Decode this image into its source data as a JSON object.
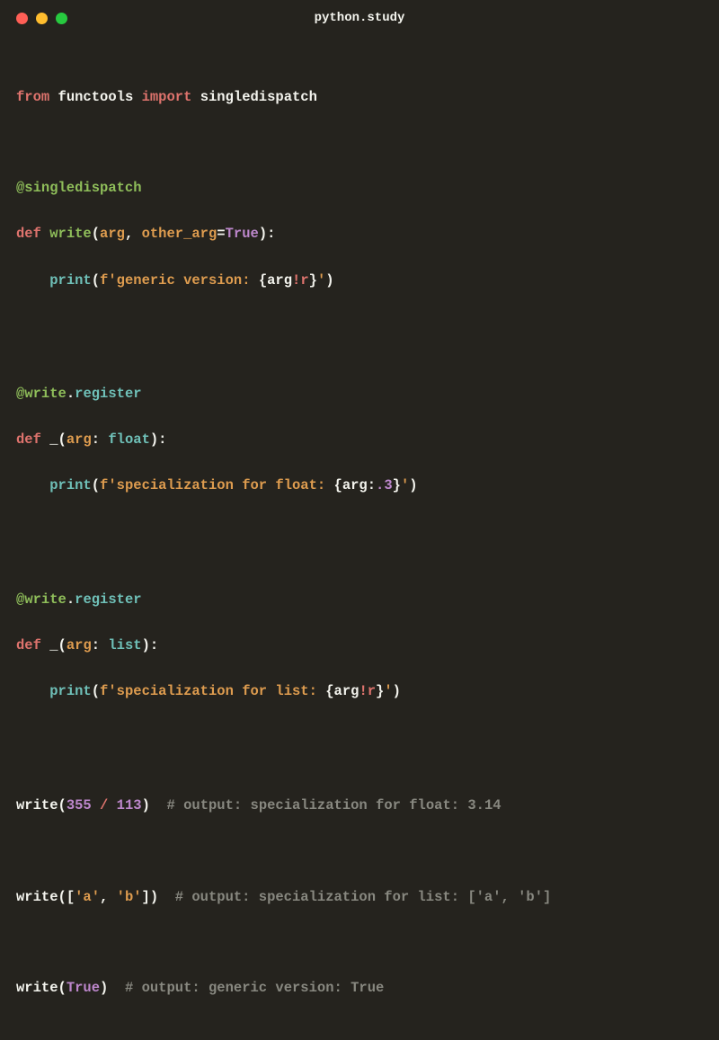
{
  "window": {
    "title": "python.study"
  },
  "code": {
    "l1": {
      "from": "from",
      "mod": "functools",
      "import": "import",
      "name": "singledispatch"
    },
    "l2": {
      "dec": "@singledispatch"
    },
    "l3": {
      "def": "def",
      "fn": "write",
      "lp": "(",
      "p1": "arg",
      "c1": ", ",
      "p2": "other_arg",
      "eq": "=",
      "true": "True",
      "rp": "):"
    },
    "l4": {
      "indent": "    ",
      "print": "print",
      "lp": "(",
      "f": "f",
      "q1": "'",
      "s1": "generic version: ",
      "lb": "{",
      "arg": "arg",
      "conv": "!r",
      "rb": "}",
      "q2": "'",
      "rp": ")"
    },
    "l5": {
      "at": "@",
      "name": "write",
      "dot": ".",
      "method": "register"
    },
    "l6": {
      "def": "def",
      "fn": "_",
      "lp": "(",
      "p1": "arg",
      "colon": ": ",
      "type": "float",
      "rp": "):"
    },
    "l7": {
      "indent": "    ",
      "print": "print",
      "lp": "(",
      "f": "f",
      "q1": "'",
      "s1": "specialization for float: ",
      "lb": "{",
      "arg": "arg",
      "colon": ":",
      "fmt": ".3",
      "rb": "}",
      "q2": "'",
      "rp": ")"
    },
    "l8": {
      "at": "@",
      "name": "write",
      "dot": ".",
      "method": "register"
    },
    "l9": {
      "def": "def",
      "fn": "_",
      "lp": "(",
      "p1": "arg",
      "colon": ": ",
      "type": "list",
      "rp": "):"
    },
    "l10": {
      "indent": "    ",
      "print": "print",
      "lp": "(",
      "f": "f",
      "q1": "'",
      "s1": "specialization for list: ",
      "lb": "{",
      "arg": "arg",
      "conv": "!r",
      "rb": "}",
      "q2": "'",
      "rp": ")"
    },
    "l11": {
      "fn": "write",
      "lp": "(",
      "n1": "355",
      "sp1": " ",
      "op": "/",
      "sp2": " ",
      "n2": "113",
      "rp": ")",
      "sp3": "  ",
      "comment": "# output: specialization for float: 3.14"
    },
    "l12": {
      "fn": "write",
      "lp": "([",
      "s1": "'a'",
      "c": ", ",
      "s2": "'b'",
      "rp": "])",
      "sp": "  ",
      "comment": "# output: specialization for list: ['a', 'b']"
    },
    "l13": {
      "fn": "write",
      "lp": "(",
      "true": "True",
      "rp": ")",
      "sp": "  ",
      "comment": "# output: generic version: True"
    }
  }
}
